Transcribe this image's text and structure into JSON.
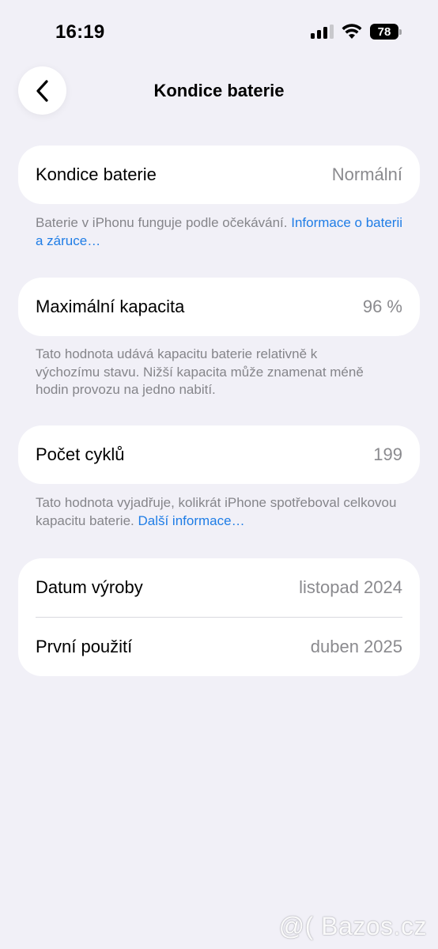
{
  "status_bar": {
    "time": "16:19",
    "battery_level": "78"
  },
  "nav": {
    "title": "Kondice baterie"
  },
  "health": {
    "label": "Kondice baterie",
    "value": "Normální"
  },
  "health_footnote": {
    "text": "Baterie v iPhonu funguje podle očekávání. ",
    "link": "Informace o baterii a záruce…"
  },
  "capacity": {
    "label": "Maximální kapacita",
    "value": "96 %"
  },
  "capacity_footnote": {
    "text": "Tato hodnota udává kapacitu baterie relativně k výchozímu stavu. Nižší kapacita může znamenat méně hodin provozu na jedno nabití."
  },
  "cycles": {
    "label": "Počet cyklů",
    "value": "199"
  },
  "cycles_footnote": {
    "text": "Tato hodnota vyjadřuje, kolikrát iPhone spotřeboval celkovou kapacitu baterie. ",
    "link": "Další informace…"
  },
  "dates": [
    {
      "label": "Datum výroby",
      "value": "listopad 2024"
    },
    {
      "label": "První použití",
      "value": "duben 2025"
    }
  ],
  "watermark": "@( Bazos.cz"
}
